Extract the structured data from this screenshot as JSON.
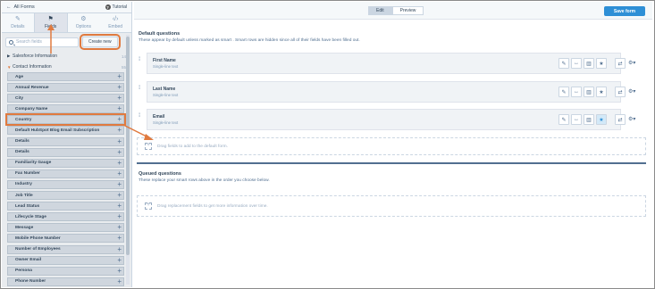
{
  "left_panel": {
    "back_label": "All Forms",
    "tutorial_label": "Tutorial",
    "tabs": [
      {
        "label": "Details",
        "icon": "pencil-icon"
      },
      {
        "label": "Fields",
        "icon": "flag-icon"
      },
      {
        "label": "Options",
        "icon": "gear-icon"
      },
      {
        "label": "Embed",
        "icon": "code-icon"
      }
    ],
    "search_placeholder": "Search fields",
    "create_new_label": "Create new",
    "groups": [
      {
        "label": "Salesforce Information",
        "count": "14",
        "expanded": false
      },
      {
        "label": "Contact Information",
        "count": "55",
        "expanded": true
      }
    ],
    "fields": [
      "Age",
      "Annual Revenue",
      "City",
      "Company Name",
      "Country",
      "Default HubSpot Blog Email Subscription",
      "Details",
      "Details",
      "Familiarity Gauge",
      "Fax Number",
      "Industry",
      "Job Title",
      "Lead Status",
      "Lifecycle Stage",
      "Message",
      "Mobile Phone Number",
      "Number of Employees",
      "Owner Email",
      "Persona",
      "Phone Number"
    ],
    "highlighted_field": "Country"
  },
  "toolbar": {
    "edit_label": "Edit",
    "preview_label": "Preview",
    "save_label": "Save form"
  },
  "default_questions": {
    "title": "Default questions",
    "description": "These appear by default unless marked as smart  . Smart rows are hidden since all of their fields have been filled out.",
    "rows": [
      {
        "name": "First Name",
        "type": "Single-line text",
        "starred": false
      },
      {
        "name": "Last Name",
        "type": "Single-line text",
        "starred": false
      },
      {
        "name": "Email",
        "type": "Single-line text",
        "starred": true
      }
    ],
    "dropzone_text": "Drag fields to add to the default form."
  },
  "queued_questions": {
    "title": "Queued questions",
    "description": "These replace your smart rows   above in the order you choose below.",
    "dropzone_text": "Drag replacement fields to get more information over time."
  },
  "colors": {
    "accent": "#2e8fd6",
    "highlight": "#e07a3f",
    "field_bg": "#cfd6de"
  }
}
